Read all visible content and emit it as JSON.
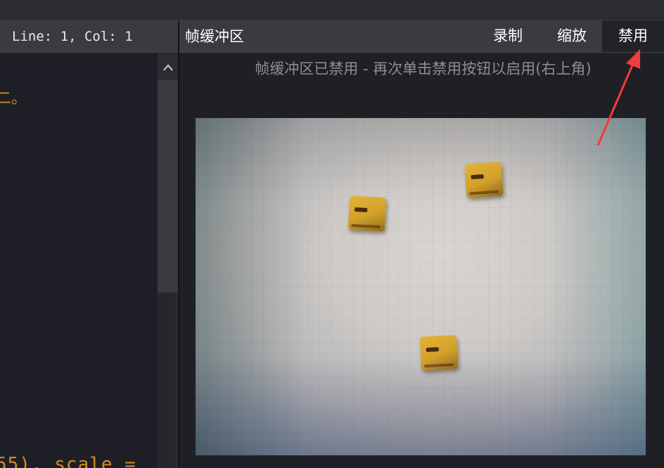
{
  "editor": {
    "status": "Line: 1, Col: 1",
    "code_line_1": "二。",
    "code_line_2": "55), scale ="
  },
  "frame_buffer": {
    "title": "帧缓冲区",
    "buttons": {
      "record": "录制",
      "zoom": "缩放",
      "disable": "禁用"
    },
    "disabled_message": "帧缓冲区已禁用 - 再次单击禁用按钮以启用(右上角)"
  },
  "icons": {
    "scroll_up": "chevron-up-icon",
    "annotation": "red-arrow-icon"
  },
  "colors": {
    "code_text": "#d28c1f",
    "panel_bg": "#1f2026",
    "header_bg": "#3a3b3f",
    "annotation_red": "#f03c3c"
  }
}
